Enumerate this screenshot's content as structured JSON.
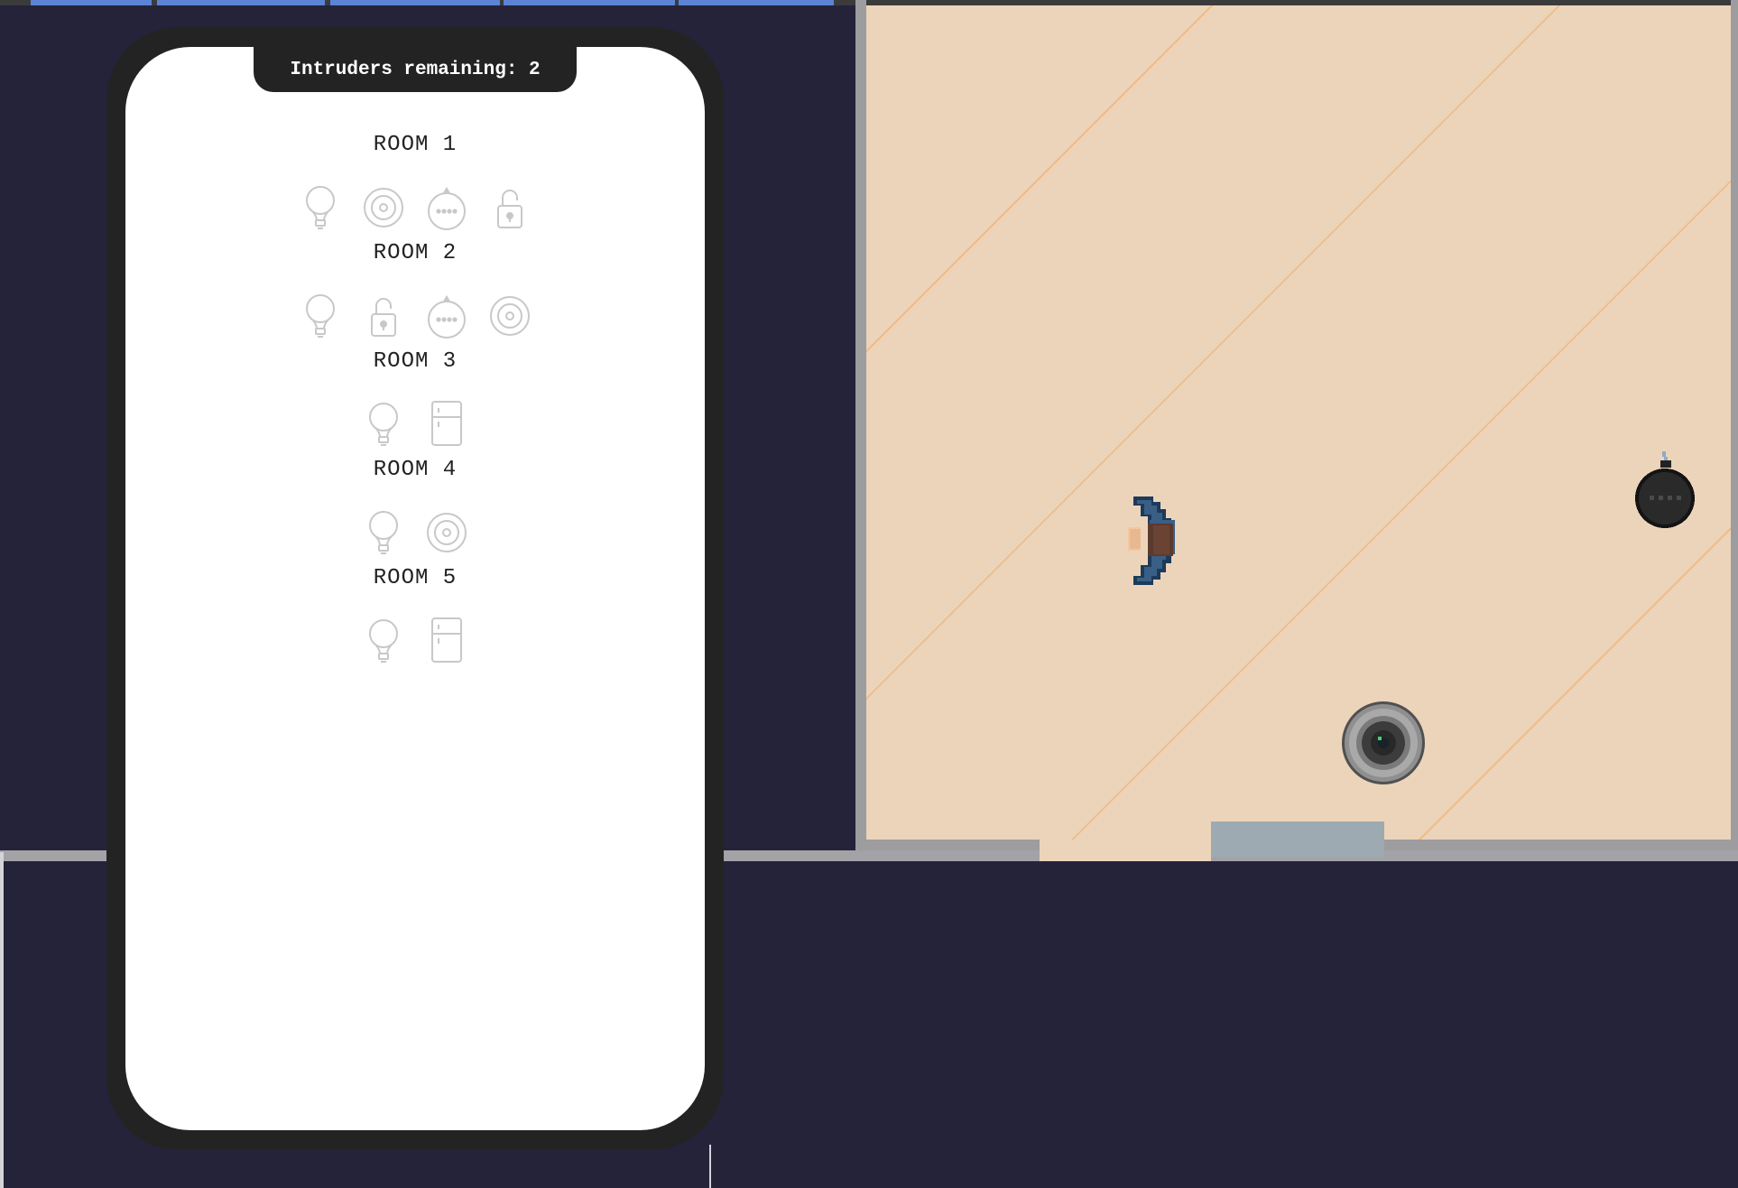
{
  "hud": {
    "intruders_label": "Intruders remaining: 2"
  },
  "phone": {
    "rooms": [
      {
        "title": "ROOM 1",
        "devices": [
          "lightbulb-icon",
          "smart-speaker-icon",
          "robot-vacuum-icon",
          "lock-icon"
        ]
      },
      {
        "title": "ROOM 2",
        "devices": [
          "lightbulb-icon",
          "lock-icon",
          "robot-vacuum-icon",
          "smart-speaker-icon"
        ]
      },
      {
        "title": "ROOM 3",
        "devices": [
          "lightbulb-icon",
          "fridge-icon"
        ]
      },
      {
        "title": "ROOM 4",
        "devices": [
          "lightbulb-icon",
          "smart-speaker-icon"
        ]
      },
      {
        "title": "ROOM 5",
        "devices": [
          "lightbulb-icon",
          "fridge-icon"
        ]
      }
    ]
  },
  "game": {
    "entities": [
      "player",
      "robot-vacuum",
      "bomb"
    ]
  },
  "colors": {
    "background": "#25233a",
    "floor": "#ecd4ba",
    "wall": "#9d9c9f",
    "phone_frame": "#232323",
    "device_icon": "#c8c8c8",
    "progress_strip": "#5b84d6"
  }
}
